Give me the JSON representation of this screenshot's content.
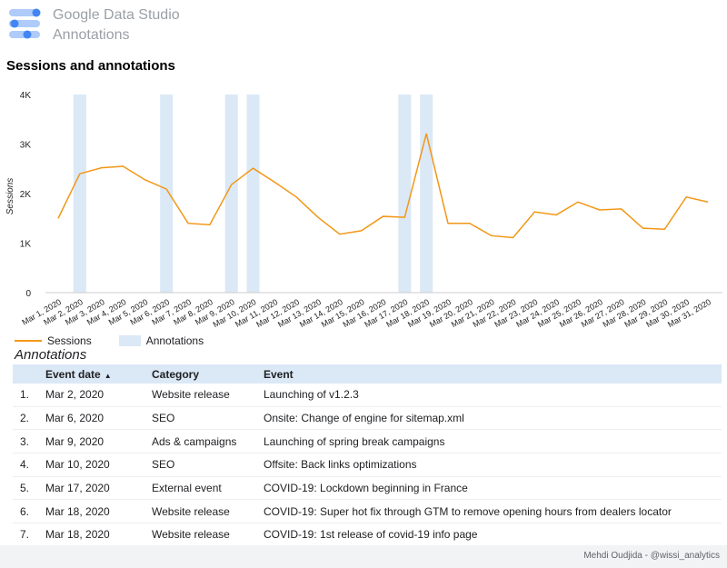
{
  "header": {
    "app_name": "Google Data Studio",
    "report_name": "Annotations"
  },
  "chart_title": "Sessions and annotations",
  "colors": {
    "series_line": "#f29716",
    "annotation_band": "#dbe8f6",
    "header_text": "#9aa0a6",
    "logo_dark": "#4285f4",
    "logo_light": "#aecbfa"
  },
  "chart_data": {
    "type": "line",
    "title": "Sessions and annotations",
    "xlabel": "",
    "ylabel": "Sessions",
    "ylim": [
      0,
      4000
    ],
    "yticks": [
      "0",
      "1K",
      "2K",
      "3K",
      "4K"
    ],
    "categories": [
      "Mar 1, 2020",
      "Mar 2, 2020",
      "Mar 3, 2020",
      "Mar 4, 2020",
      "Mar 5, 2020",
      "Mar 6, 2020",
      "Mar 7, 2020",
      "Mar 8, 2020",
      "Mar 9, 2020",
      "Mar 10, 2020",
      "Mar 11, 2020",
      "Mar 12, 2020",
      "Mar 13, 2020",
      "Mar 14, 2020",
      "Mar 15, 2020",
      "Mar 16, 2020",
      "Mar 17, 2020",
      "Mar 18, 2020",
      "Mar 19, 2020",
      "Mar 20, 2020",
      "Mar 21, 2020",
      "Mar 22, 2020",
      "Mar 23, 2020",
      "Mar 24, 2020",
      "Mar 25, 2020",
      "Mar 26, 2020",
      "Mar 27, 2020",
      "Mar 28, 2020",
      "Mar 29, 2020",
      "Mar 30, 2020",
      "Mar 31, 2020"
    ],
    "series": [
      {
        "name": "Sessions",
        "values": [
          1500,
          2400,
          2520,
          2550,
          2280,
          2090,
          1400,
          1370,
          2180,
          2510,
          2230,
          1930,
          1520,
          1180,
          1250,
          1540,
          1520,
          3210,
          1400,
          1400,
          1150,
          1110,
          1630,
          1570,
          1830,
          1670,
          1690,
          1300,
          1280,
          1930,
          1830
        ]
      },
      {
        "name": "Annotations",
        "marked_dates": [
          "Mar 2, 2020",
          "Mar 6, 2020",
          "Mar 9, 2020",
          "Mar 10, 2020",
          "Mar 17, 2020",
          "Mar 18, 2020"
        ]
      }
    ],
    "legend": [
      "Sessions",
      "Annotations"
    ],
    "legend_position": "bottom-left",
    "grid": false
  },
  "annotations_table": {
    "title": "Annotations",
    "columns": [
      "",
      "Event date",
      "Category",
      "Event"
    ],
    "sort_indicator": "▲",
    "rows": [
      {
        "num": "1.",
        "date": "Mar 2, 2020",
        "category": "Website release",
        "event": "Launching of v1.2.3"
      },
      {
        "num": "2.",
        "date": "Mar 6, 2020",
        "category": "SEO",
        "event": "Onsite: Change of engine for sitemap.xml"
      },
      {
        "num": "3.",
        "date": "Mar 9, 2020",
        "category": "Ads & campaigns",
        "event": "Launching of spring break campaigns"
      },
      {
        "num": "4.",
        "date": "Mar 10, 2020",
        "category": "SEO",
        "event": "Offsite: Back links optimizations"
      },
      {
        "num": "5.",
        "date": "Mar 17, 2020",
        "category": "External event",
        "event": "COVID-19: Lockdown beginning in France"
      },
      {
        "num": "6.",
        "date": "Mar 18, 2020",
        "category": "Website release",
        "event": "COVID-19: Super hot fix through GTM to remove opening hours from dealers locator"
      },
      {
        "num": "7.",
        "date": "Mar 18, 2020",
        "category": "Website release",
        "event": "COVID-19: 1st release of covid-19 info page"
      }
    ]
  },
  "footer": {
    "credit": "Mehdi Oudjida - @wissi_analytics"
  }
}
